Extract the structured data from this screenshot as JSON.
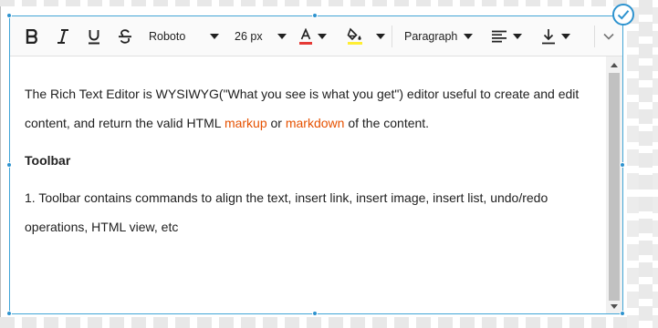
{
  "toolbar": {
    "font_family": "Roboto",
    "font_size": "26 px",
    "format": "Paragraph",
    "font_color": "#e53935",
    "background_color": "#ffee33",
    "icons": [
      "bold-icon",
      "italic-icon",
      "underline-icon",
      "strikethrough-icon",
      "font-color-icon",
      "background-color-icon",
      "align-left-icon",
      "insert-icon",
      "more-icon"
    ]
  },
  "content": {
    "p1_text1": "The Rich Text Editor is WYSIWYG(\"What you see is what you get\") editor useful to create and edit content, and return the valid HTML ",
    "p1_link1": "markup",
    "p1_text2": " or ",
    "p1_link2": "markdown",
    "p1_text3": " of the content.",
    "heading": "Toolbar",
    "p2": "1. Toolbar contains commands to align the text, insert link, insert image, insert list, undo/redo operations, HTML view,  etc"
  },
  "colors": {
    "link": "#e65100",
    "selection": "#42a5d6",
    "accent": "#2e93cf"
  }
}
